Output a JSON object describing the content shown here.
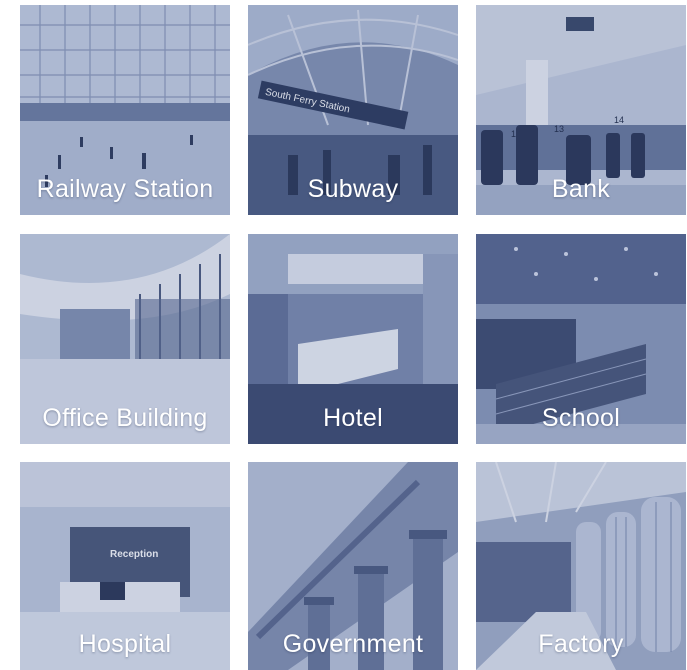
{
  "tiles": [
    {
      "label": "Railway Station",
      "icon": "railway-station-photo"
    },
    {
      "label": "Subway",
      "icon": "subway-photo",
      "sign_text": "South Ferry Station"
    },
    {
      "label": "Bank",
      "icon": "bank-photo",
      "counter_numbers": [
        "12",
        "13",
        "14"
      ]
    },
    {
      "label": "Office Building",
      "icon": "office-building-photo"
    },
    {
      "label": "Hotel",
      "icon": "hotel-photo"
    },
    {
      "label": "School",
      "icon": "school-photo"
    },
    {
      "label": "Hospital",
      "icon": "hospital-photo",
      "sign_text": "Reception"
    },
    {
      "label": "Government",
      "icon": "government-photo"
    },
    {
      "label": "Factory",
      "icon": "factory-photo"
    }
  ],
  "colors": {
    "tint_light": "#c7cfe0",
    "tint_mid": "#8a98b8",
    "tint_dark": "#3f4e72",
    "label_text": "#ffffff"
  }
}
